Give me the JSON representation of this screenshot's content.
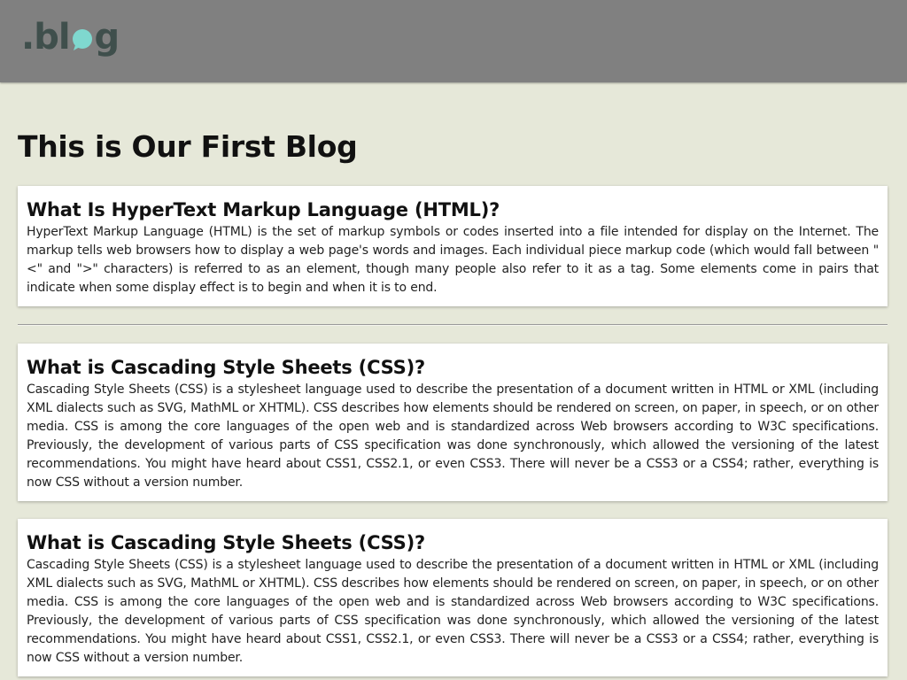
{
  "header": {
    "logo_text_prefix": ".bl",
    "logo_text_suffix": "g",
    "logo_icon": "speech-bubble-o-icon",
    "colors": {
      "bar": "#808080",
      "logo_text": "#3f4f4c",
      "logo_bubble": "#7fd8cf"
    }
  },
  "page": {
    "title": "This is Our First Blog",
    "background": "#e6e8d9"
  },
  "posts": [
    {
      "title": "What Is HyperText Markup Language (HTML)?",
      "body": "HyperText Markup Language (HTML) is the set of markup symbols or codes inserted into a file intended for display on the Internet. The markup tells web browsers how to display a web page's words and images. Each individual piece markup code (which would fall between \"<\" and \">\" characters) is referred to as an element, though many people also refer to it as a tag. Some elements come in pairs that indicate when some display effect is to begin and when it is to end."
    },
    {
      "title": "What is Cascading Style Sheets (CSS)?",
      "body": "Cascading Style Sheets (CSS) is a stylesheet language used to describe the presentation of a document written in HTML or XML (including XML dialects such as SVG, MathML or XHTML). CSS describes how elements should be rendered on screen, on paper, in speech, or on other media. CSS is among the core languages of the open web and is standardized across Web browsers according to W3C specifications. Previously, the development of various parts of CSS specification was done synchronously, which allowed the versioning of the latest recommendations. You might have heard about CSS1, CSS2.1, or even CSS3. There will never be a CSS3 or a CSS4; rather, everything is now CSS without a version number."
    },
    {
      "title": "What is Cascading Style Sheets (CSS)?",
      "body": "Cascading Style Sheets (CSS) is a stylesheet language used to describe the presentation of a document written in HTML or XML (including XML dialects such as SVG, MathML or XHTML). CSS describes how elements should be rendered on screen, on paper, in speech, or on other media. CSS is among the core languages of the open web and is standardized across Web browsers according to W3C specifications. Previously, the development of various parts of CSS specification was done synchronously, which allowed the versioning of the latest recommendations. You might have heard about CSS1, CSS2.1, or even CSS3. There will never be a CSS3 or a CSS4; rather, everything is now CSS without a version number."
    }
  ]
}
